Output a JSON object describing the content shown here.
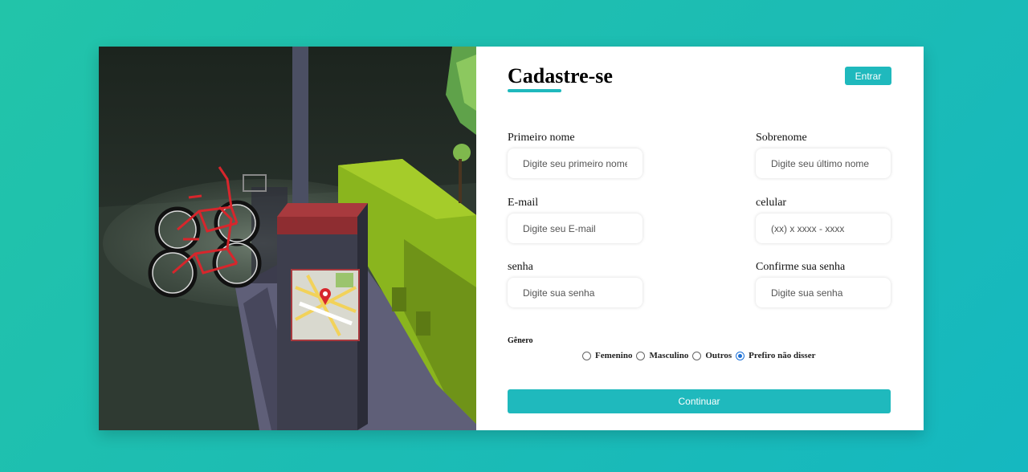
{
  "form": {
    "title": "Cadastre-se",
    "login_button": "Entrar",
    "fields": {
      "first_name": {
        "label": "Primeiro nome",
        "placeholder": "Digite seu primeiro nome"
      },
      "last_name": {
        "label": "Sobrenome",
        "placeholder": "Digite seu último nome"
      },
      "email": {
        "label": "E-mail",
        "placeholder": "Digite seu E-mail"
      },
      "phone": {
        "label": "celular",
        "placeholder": "(xx) x xxxx - xxxx"
      },
      "password": {
        "label": "senha",
        "placeholder": "Digite sua senha"
      },
      "confirm_password": {
        "label": "Confirme sua senha",
        "placeholder": "Digite sua senha"
      }
    },
    "gender": {
      "title": "Gênero",
      "options": [
        "Femenino",
        "Masculino",
        "Outros",
        "Prefiro não disser"
      ],
      "selected": "Prefiro não disser"
    },
    "submit_button": "Continuar"
  },
  "colors": {
    "accent": "#1fb9bd",
    "background": "#1cbcb4",
    "radio_selected": "#1a6fd6"
  }
}
